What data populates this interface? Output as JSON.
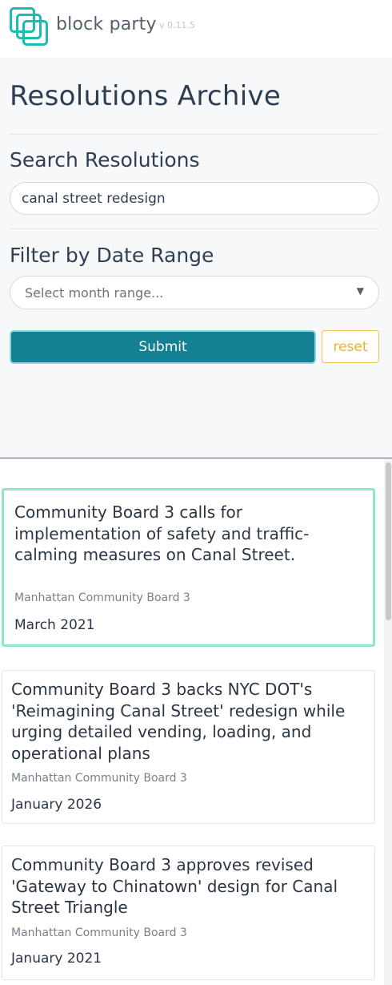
{
  "header": {
    "app_name": "block party",
    "version": "v 0.11.5",
    "logo_icon": "overlapping-squares-logo",
    "accent": "#1dbcb0"
  },
  "panel": {
    "title": "Resolutions Archive",
    "search": {
      "label": "Search Resolutions",
      "value": "canal street redesign"
    },
    "date_filter": {
      "label": "Filter by Date Range",
      "placeholder": "Select month range...",
      "arrow_icon": "▼"
    },
    "submit_label": "Submit",
    "reset_label": "reset",
    "colors": {
      "submit": "#148093",
      "reset": "#e9b329"
    }
  },
  "results": [
    {
      "title": "Community Board 3 calls for implementation of safety and traffic-calming measures on Canal Street.",
      "board": "Manhattan Community Board 3",
      "date": "March 2021",
      "selected": true
    },
    {
      "title": "Community Board 3 backs NYC DOT's 'Reimagining Canal Street' redesign while urging detailed vending, loading, and operational plans",
      "board": "Manhattan Community Board 3",
      "date": "January 2026",
      "selected": false
    },
    {
      "title": "Community Board 3 approves revised 'Gateway to Chinatown' design for Canal Street Triangle",
      "board": "Manhattan Community Board 3",
      "date": "January 2021",
      "selected": false
    }
  ]
}
